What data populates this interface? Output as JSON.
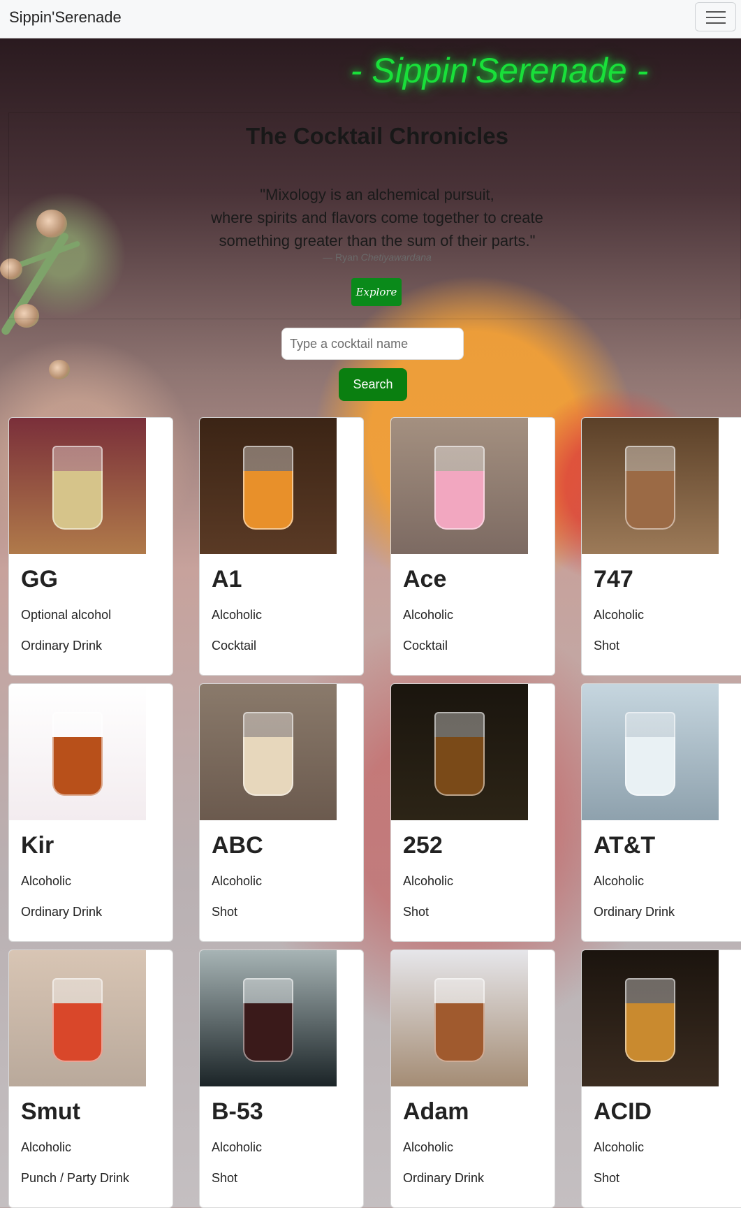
{
  "navbar": {
    "brand": "Sippin'Serenade"
  },
  "hero": {
    "title": "- Sippin'Serenade -",
    "subtitle": "The Cocktail Chronicles",
    "quote_lines": [
      "\"Mixology is an alchemical pursuit,",
      "where spirits and flavors come together to create",
      "something greater than the sum of their parts.\""
    ],
    "author_prefix": "— Ryan",
    "author_name": "Chetiyawardana",
    "explore_label": "Explore"
  },
  "search": {
    "placeholder": "Type a cocktail name",
    "button_label": "Search"
  },
  "cards": [
    {
      "name": "GG",
      "alcoholic": "Optional alcohol",
      "category": "Ordinary Drink",
      "bg": "#b07a4a",
      "top": "#7a2f3a",
      "drink": "#d6c48a"
    },
    {
      "name": "A1",
      "alcoholic": "Alcoholic",
      "category": "Cocktail",
      "bg": "#5a3a25",
      "top": "#3b2415",
      "drink": "#e8902a"
    },
    {
      "name": "Ace",
      "alcoholic": "Alcoholic",
      "category": "Cocktail",
      "bg": "#7c6a62",
      "top": "#a49080",
      "drink": "#f2a7c0"
    },
    {
      "name": "747",
      "alcoholic": "Alcoholic",
      "category": "Shot",
      "bg": "#9c7a58",
      "top": "#5b4028",
      "drink": "#9b6a45"
    },
    {
      "name": "Kir",
      "alcoholic": "Alcoholic",
      "category": "Ordinary Drink",
      "bg": "#f3ecef",
      "top": "#ffffff",
      "drink": "#b8501a"
    },
    {
      "name": "ABC",
      "alcoholic": "Alcoholic",
      "category": "Shot",
      "bg": "#6b5a4e",
      "top": "#8a7a6b",
      "drink": "#e7d7bc"
    },
    {
      "name": "252",
      "alcoholic": "Alcoholic",
      "category": "Shot",
      "bg": "#2c2416",
      "top": "#1a150e",
      "drink": "#7a4a18"
    },
    {
      "name": "AT&T",
      "alcoholic": "Alcoholic",
      "category": "Ordinary Drink",
      "bg": "#8ea1ad",
      "top": "#c6d6df",
      "drink": "#e9f1f4"
    },
    {
      "name": "Smut",
      "alcoholic": "Alcoholic",
      "category": "Punch / Party Drink",
      "bg": "#b9a99b",
      "top": "#d8c5b4",
      "drink": "#d9472a"
    },
    {
      "name": "B-53",
      "alcoholic": "Alcoholic",
      "category": "Shot",
      "bg": "#1b2427",
      "top": "#a7b4b5",
      "drink": "#3a1a1a"
    },
    {
      "name": "Adam",
      "alcoholic": "Alcoholic",
      "category": "Ordinary Drink",
      "bg": "#a48c74",
      "top": "#e6e6ea",
      "drink": "#a05a2e"
    },
    {
      "name": "ACID",
      "alcoholic": "Alcoholic",
      "category": "Shot",
      "bg": "#3b2c20",
      "top": "#1b140e",
      "drink": "#c98a2f"
    }
  ]
}
